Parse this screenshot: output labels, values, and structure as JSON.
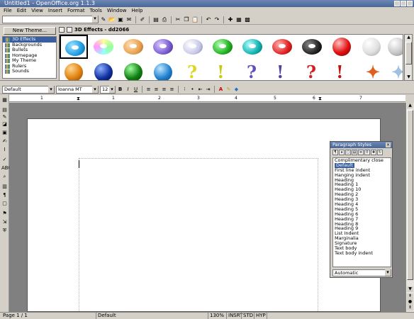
{
  "window": {
    "title": "Untitled1 - OpenOffice.org 1.1.3"
  },
  "menu": [
    "File",
    "Edit",
    "View",
    "Insert",
    "Format",
    "Tools",
    "Window",
    "Help"
  ],
  "gallery": {
    "new_theme_label": "New Theme...",
    "current_title": "3D Effects - dd2066",
    "themes": [
      "3D Effects",
      "Backgrounds",
      "Bullets",
      "Homepage",
      "My Theme",
      "Rulers",
      "Sounds"
    ],
    "selected_theme": "3D Effects"
  },
  "formatting": {
    "paragraph_style": "Default",
    "font_name": "Ioanna MT",
    "font_size": "12",
    "bold": "B",
    "italic": "I",
    "underline": "U"
  },
  "ruler": {
    "numbers": [
      "1",
      "1",
      "2",
      "3",
      "4",
      "5",
      "6",
      "7"
    ]
  },
  "stylist": {
    "title": "Paragraph Styles",
    "items": [
      "Complimentary close",
      "Default",
      "First line indent",
      "Hanging indent",
      "Heading",
      "Heading 1",
      "Heading 10",
      "Heading 2",
      "Heading 3",
      "Heading 4",
      "Heading 5",
      "Heading 6",
      "Heading 7",
      "Heading 8",
      "Heading 9",
      "List Indent",
      "Marginalia",
      "Signature",
      "Text body",
      "Text body indent"
    ],
    "selected": "Default",
    "filter": "Automatic"
  },
  "status": {
    "page": "Page 1 / 1",
    "style": "Default",
    "zoom": "130%",
    "insert_mode": "INSRT",
    "selection_mode": "STD",
    "hyperlink_mode": "HYP"
  }
}
